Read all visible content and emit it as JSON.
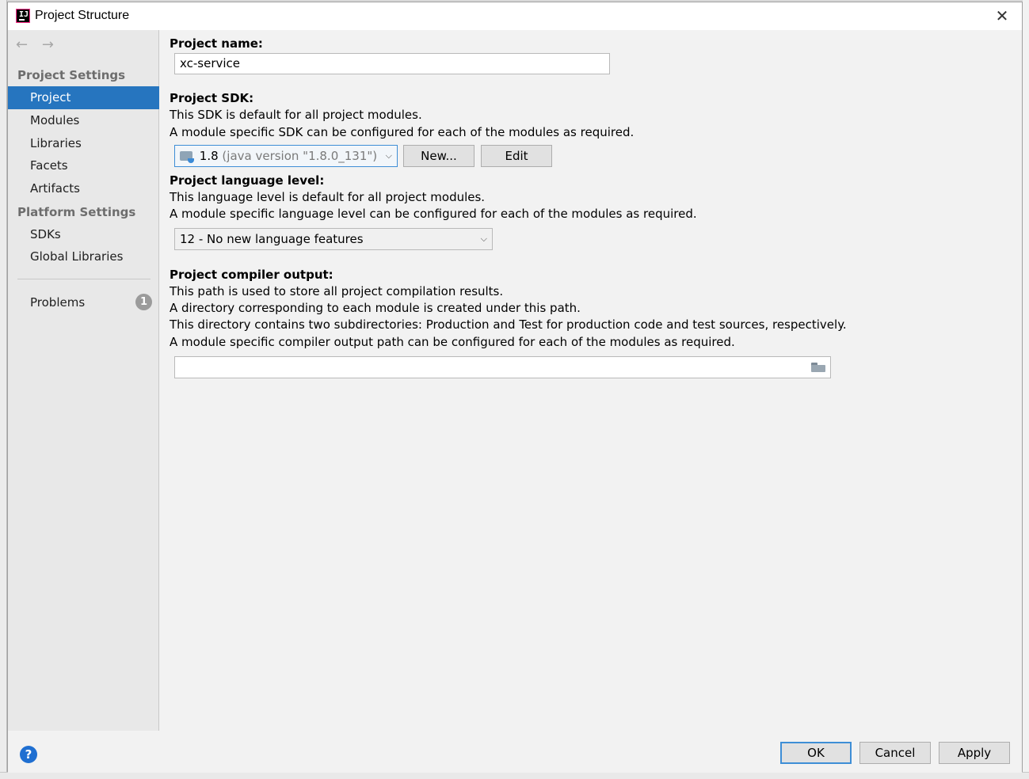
{
  "window": {
    "title": "Project Structure",
    "close_label": "✕"
  },
  "nav": {
    "back": "←",
    "forward": "→"
  },
  "sidebar": {
    "project_settings_header": "Project Settings",
    "platform_settings_header": "Platform Settings",
    "items": [
      {
        "label": "Project",
        "selected": true
      },
      {
        "label": "Modules"
      },
      {
        "label": "Libraries"
      },
      {
        "label": "Facets"
      },
      {
        "label": "Artifacts"
      },
      {
        "label": "SDKs"
      },
      {
        "label": "Global Libraries"
      }
    ],
    "problems": {
      "label": "Problems",
      "count": "1"
    }
  },
  "content": {
    "project_name_label": "Project name:",
    "project_name_value": "xc-service",
    "sdk_label": "Project SDK:",
    "sdk_desc_1": "This SDK is default for all project modules.",
    "sdk_desc_2": "A module specific SDK can be configured for each of the modules as required.",
    "sdk_selected_version": "1.8",
    "sdk_selected_detail": "(java version \"1.8.0_131\")",
    "sdk_new_button": "New...",
    "sdk_edit_button": "Edit",
    "lang_label": "Project language level:",
    "lang_desc_1": "This language level is default for all project modules.",
    "lang_desc_2": "A module specific language level can be configured for each of the modules as required.",
    "lang_selected": "12 - No new language features",
    "output_label": "Project compiler output:",
    "output_desc_1": "This path is used to store all project compilation results.",
    "output_desc_2": "A directory corresponding to each module is created under this path.",
    "output_desc_3": "This directory contains two subdirectories: Production and Test for production code and test sources, respectively.",
    "output_desc_4": "A module specific compiler output path can be configured for each of the modules as required.",
    "output_path_value": ""
  },
  "footer": {
    "help_label": "?",
    "ok_button": "OK",
    "cancel_button": "Cancel",
    "apply_button": "Apply"
  },
  "colors": {
    "selection": "#2675bf",
    "focus_border": "#3e8ed6",
    "sidebar_bg": "#e8e8e8",
    "dialog_bg": "#f2f2f2"
  },
  "icons": {
    "app": "intellij-idea-icon",
    "sdk": "jdk-folder-icon",
    "browse": "folder-open-icon",
    "help": "help-circle-icon"
  }
}
